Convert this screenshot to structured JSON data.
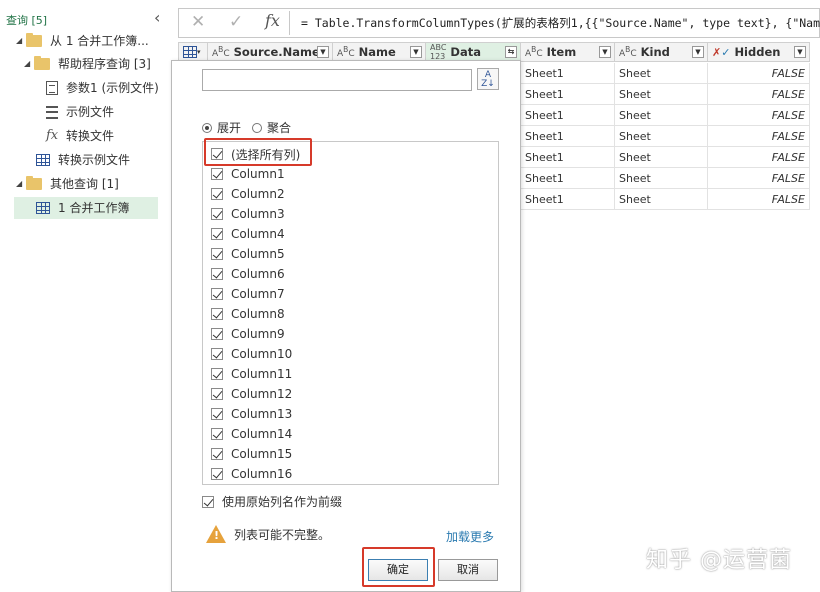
{
  "query_pane": {
    "header": "查询 [5]",
    "items": [
      {
        "label": "从 1 合并工作簿...",
        "icon": "folder-icon",
        "expanded": true
      },
      {
        "label": "帮助程序查询 [3]",
        "icon": "folder-icon",
        "expanded": true
      },
      {
        "label": "参数1 (示例文件)",
        "icon": "parameter-icon"
      },
      {
        "label": "示例文件",
        "icon": "list-icon"
      },
      {
        "label": "转换文件",
        "icon": "function-icon"
      },
      {
        "label": "转换示例文件",
        "icon": "table-icon"
      },
      {
        "label": "其他查询 [1]",
        "icon": "folder-icon",
        "expanded": true
      },
      {
        "label": "1 合并工作簿",
        "icon": "table-icon",
        "selected": true
      }
    ]
  },
  "formula_bar": {
    "cancel_symbol": "✕",
    "confirm_symbol": "✓",
    "fx_symbol": "fx",
    "formula": "= Table.TransformColumnTypes(扩展的表格列1,{{\"Source.Name\", type text}, {\"Name\","
  },
  "grid": {
    "columns": [
      {
        "name": "Source.Name",
        "type": "ABC"
      },
      {
        "name": "Name",
        "type": "ABC"
      },
      {
        "name": "Data",
        "type": "ABC123",
        "highlighted": true
      },
      {
        "name": "Item",
        "type": "ABC"
      },
      {
        "name": "Kind",
        "type": "ABC"
      },
      {
        "name": "Hidden",
        "type": "boolean"
      }
    ],
    "visible_rows": [
      {
        "Item": "Sheet1",
        "Kind": "Sheet",
        "Hidden": "FALSE"
      },
      {
        "Item": "Sheet1",
        "Kind": "Sheet",
        "Hidden": "FALSE"
      },
      {
        "Item": "Sheet1",
        "Kind": "Sheet",
        "Hidden": "FALSE"
      },
      {
        "Item": "Sheet1",
        "Kind": "Sheet",
        "Hidden": "FALSE"
      },
      {
        "Item": "Sheet1",
        "Kind": "Sheet",
        "Hidden": "FALSE"
      },
      {
        "Item": "Sheet1",
        "Kind": "Sheet",
        "Hidden": "FALSE"
      },
      {
        "Item": "Sheet1",
        "Kind": "Sheet",
        "Hidden": "FALSE"
      }
    ]
  },
  "expand_panel": {
    "search_value": "",
    "sort_icon": "sort-az-icon",
    "mode_expand": "展开",
    "mode_aggregate": "聚合",
    "selected_mode": "展开",
    "select_all": "(选择所有列)",
    "columns": [
      "Column1",
      "Column2",
      "Column3",
      "Column4",
      "Column5",
      "Column6",
      "Column7",
      "Column8",
      "Column9",
      "Column10",
      "Column11",
      "Column12",
      "Column13",
      "Column14",
      "Column15",
      "Column16"
    ],
    "use_prefix": "使用原始列名作为前缀",
    "warning": "列表可能不完整。",
    "load_more": "加载更多",
    "ok": "确定",
    "cancel": "取消"
  },
  "watermark": "知乎 @运营菌",
  "colors": {
    "accent_green": "#217346",
    "selection_green": "#dff0e3",
    "highlight_red": "#d63a2a",
    "link_blue": "#2a7ab0",
    "warning_orange": "#e6a23c"
  }
}
